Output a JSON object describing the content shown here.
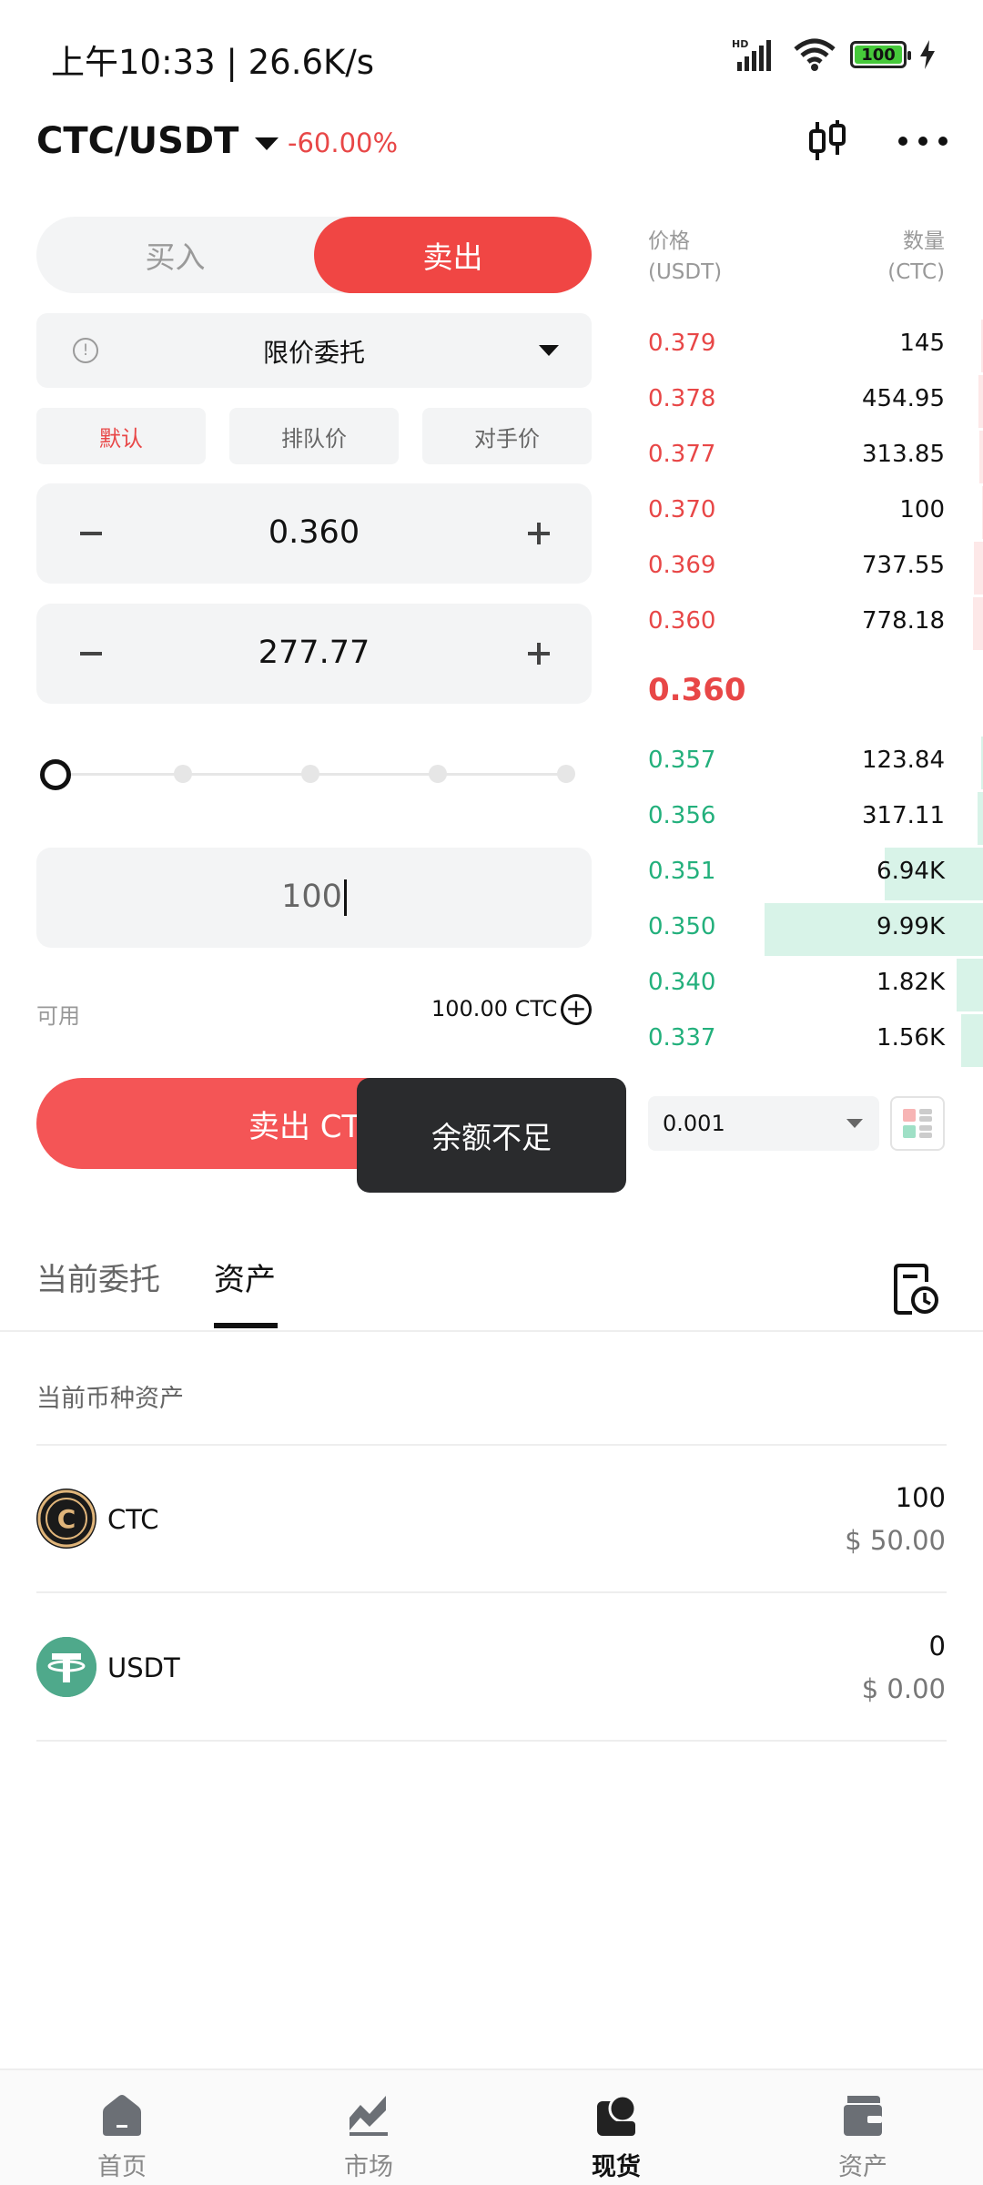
{
  "status_bar": {
    "time": "上午10:33 | 26.6K/s",
    "battery": "100",
    "network": "HD"
  },
  "header": {
    "pair": "CTC/USDT",
    "change": "-60.00%"
  },
  "trade": {
    "buy_label": "买入",
    "sell_label": "卖出",
    "order_type": "限价委托",
    "chips": [
      "默认",
      "排队价",
      "对手价"
    ],
    "price": "0.360",
    "quantity": "277.77",
    "amount": "100",
    "available_label": "可用",
    "available_value": "100.00 CTC",
    "submit_label": "卖出 CTC",
    "toast": "余额不足"
  },
  "order_book": {
    "price_header": "价格",
    "price_unit": "(USDT)",
    "qty_header": "数量",
    "qty_unit": "(CTC)",
    "asks": [
      {
        "price": "0.379",
        "qty": "145",
        "depth": 0.01
      },
      {
        "price": "0.378",
        "qty": "454.95",
        "depth": 0.02
      },
      {
        "price": "0.377",
        "qty": "313.85",
        "depth": 0.015
      },
      {
        "price": "0.370",
        "qty": "100",
        "depth": 0.005
      },
      {
        "price": "0.369",
        "qty": "737.55",
        "depth": 0.04
      },
      {
        "price": "0.360",
        "qty": "778.18",
        "depth": 0.045
      }
    ],
    "mid_price": "0.360",
    "bids": [
      {
        "price": "0.357",
        "qty": "123.84",
        "depth": 0.01
      },
      {
        "price": "0.356",
        "qty": "317.11",
        "depth": 0.025
      },
      {
        "price": "0.351",
        "qty": "6.94K",
        "depth": 0.45
      },
      {
        "price": "0.350",
        "qty": "9.99K",
        "depth": 1.0
      },
      {
        "price": "0.340",
        "qty": "1.82K",
        "depth": 0.12
      },
      {
        "price": "0.337",
        "qty": "1.56K",
        "depth": 0.1
      }
    ],
    "depth_step": "0.001"
  },
  "tabs": [
    {
      "label": "当前委托",
      "active": false
    },
    {
      "label": "资产",
      "active": true
    }
  ],
  "assets": {
    "section_title": "当前币种资产",
    "items": [
      {
        "name": "CTC",
        "amount": "100",
        "usd": "$ 50.00"
      },
      {
        "name": "USDT",
        "amount": "0",
        "usd": "$ 0.00"
      }
    ]
  },
  "nav": [
    {
      "label": "首页",
      "icon": "home-icon",
      "active": false
    },
    {
      "label": "市场",
      "icon": "market-chart-icon",
      "active": false
    },
    {
      "label": "现货",
      "icon": "spot-icon",
      "active": true
    },
    {
      "label": "资产",
      "icon": "wallet-icon",
      "active": false
    }
  ],
  "colors": {
    "sell": "#f04644",
    "ask": "#e84747",
    "bid": "#23b07c",
    "bid_bar": "#d8f3e8",
    "ask_bar": "#fde8e8"
  }
}
